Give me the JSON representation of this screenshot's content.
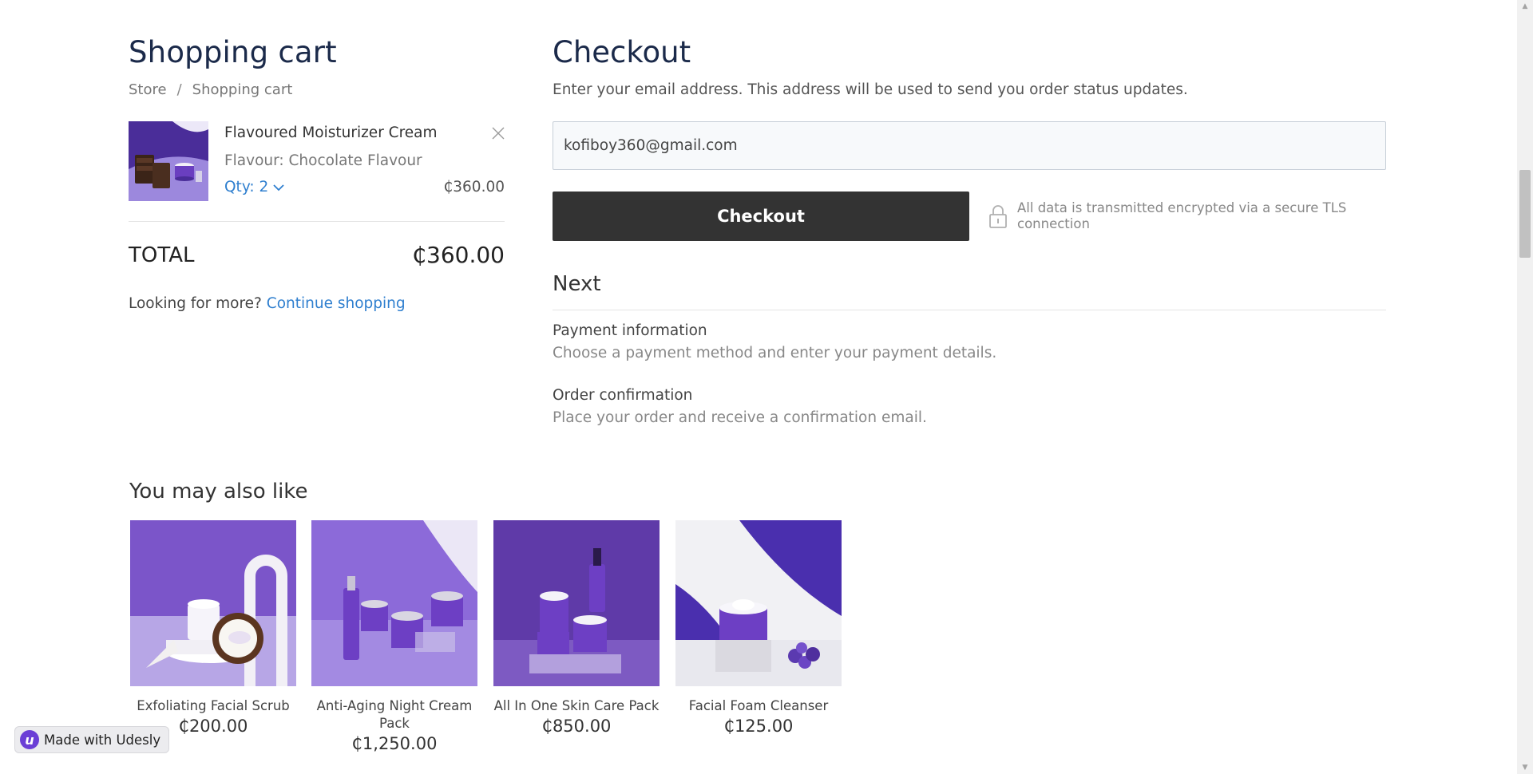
{
  "cart": {
    "title": "Shopping cart",
    "breadcrumb": {
      "store": "Store",
      "separator": "/",
      "current": "Shopping cart"
    },
    "item": {
      "name": "Flavoured Moisturizer Cream",
      "variant": "Flavour: Chocolate Flavour",
      "qty_label": "Qty: 2",
      "price": "₵360.00"
    },
    "total_label": "TOTAL",
    "total_value": "₵360.00",
    "more_text": "Looking for more?",
    "continue_link": "Continue shopping"
  },
  "checkout": {
    "title": "Checkout",
    "description": "Enter your email address. This address will be used to send you order status updates.",
    "email_value": "kofiboy360@gmail.com",
    "button_label": "Checkout",
    "secure_note": "All data is transmitted encrypted via a secure TLS connection",
    "next_title": "Next",
    "steps": [
      {
        "title": "Payment information",
        "desc": "Choose a payment method and enter your payment details."
      },
      {
        "title": "Order confirmation",
        "desc": "Place your order and receive a confirmation email."
      }
    ]
  },
  "recommendations": {
    "title": "You may also like",
    "items": [
      {
        "name": "Exfoliating Facial Scrub",
        "price": "₵200.00"
      },
      {
        "name": "Anti-Aging Night Cream Pack",
        "price": "₵1,250.00"
      },
      {
        "name": "All In One Skin Care Pack",
        "price": "₵850.00"
      },
      {
        "name": "Facial Foam Cleanser",
        "price": "₵125.00"
      }
    ]
  },
  "badge": {
    "logo": "u",
    "label": "Made with Udesly"
  },
  "icons": {
    "remove": "close-icon",
    "qty": "chevron-down-icon",
    "secure": "lock-icon",
    "badge": "udesly-logo-icon"
  },
  "colors": {
    "heading": "#1b2a4a",
    "link": "#2f7fcf",
    "button": "#333333",
    "brand_purple": "#6b3fd6"
  }
}
